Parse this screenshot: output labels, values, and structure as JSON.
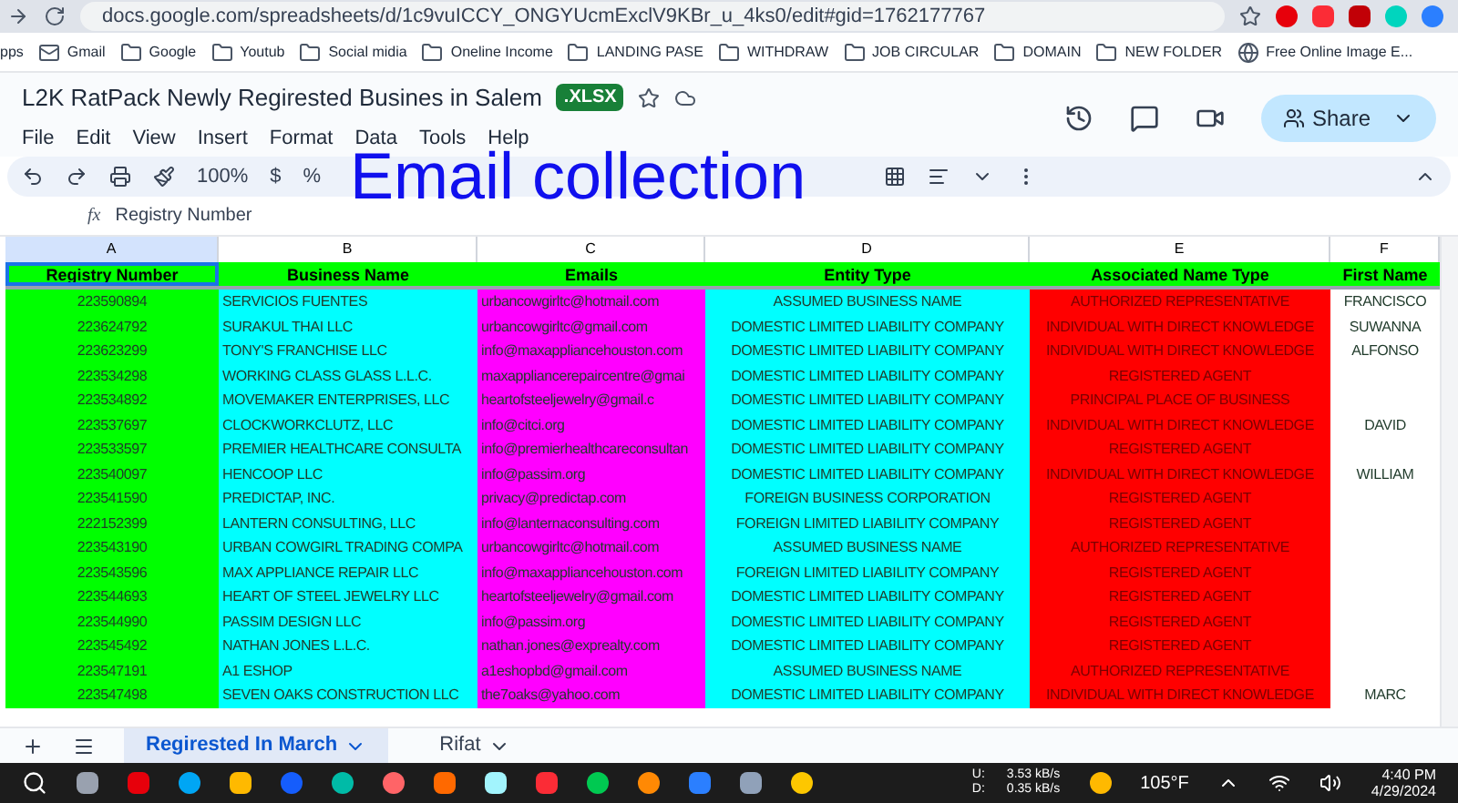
{
  "browser": {
    "url": "docs.google.com/spreadsheets/d/1c9vuICCY_ONGYUcmExclV9KBr_u_4ks0/edit#gid=1762177767",
    "bookmarks": [
      {
        "label": "pps",
        "kind": "apps"
      },
      {
        "label": "Gmail",
        "kind": "mail"
      },
      {
        "label": "Google",
        "kind": "folder"
      },
      {
        "label": "Youtub",
        "kind": "folder"
      },
      {
        "label": "Social midia",
        "kind": "folder"
      },
      {
        "label": "Oneline Income",
        "kind": "folder"
      },
      {
        "label": "LANDING PASE",
        "kind": "folder"
      },
      {
        "label": "WITHDRAW",
        "kind": "folder"
      },
      {
        "label": "JOB CIRCULAR",
        "kind": "folder"
      },
      {
        "label": "DOMAIN",
        "kind": "folder"
      },
      {
        "label": "NEW FOLDER",
        "kind": "folder"
      },
      {
        "label": "Free Online Image E...",
        "kind": "site"
      }
    ]
  },
  "doc": {
    "title": "L2K RatPack Newly Regirested Busines in Salem",
    "badge": ".XLSX",
    "menu": [
      "File",
      "Edit",
      "View",
      "Insert",
      "Format",
      "Data",
      "Tools",
      "Help"
    ],
    "share": "Share",
    "zoom": "100%",
    "currency": "$",
    "percent": "%",
    "overlay": "Email collection"
  },
  "formula_bar": {
    "fx": "fx",
    "value": "Registry Number"
  },
  "table": {
    "columns": [
      {
        "letter": "A",
        "header": "Registry Number",
        "color": "#00ff00",
        "selected": true
      },
      {
        "letter": "B",
        "header": "Business Name",
        "color": "#00ffff",
        "selected": false
      },
      {
        "letter": "C",
        "header": "Emails",
        "color": "#ff00ff",
        "selected": false
      },
      {
        "letter": "D",
        "header": "Entity Type",
        "color": "#00ffff",
        "selected": false
      },
      {
        "letter": "E",
        "header": "Associated Name Type",
        "color": "#ff0000",
        "selected": false
      },
      {
        "letter": "F",
        "header": "First Name",
        "color": "#ffffff",
        "selected": false
      }
    ],
    "rows": [
      [
        "223590894",
        "SERVICIOS FUENTES",
        "urbancowgirltc@hotmail.com",
        "ASSUMED BUSINESS NAME",
        "AUTHORIZED REPRESENTATIVE",
        "FRANCISCO"
      ],
      [
        "223624792",
        "SURAKUL THAI LLC",
        "urbancowgirltc@gmail.com",
        "DOMESTIC LIMITED LIABILITY COMPANY",
        "INDIVIDUAL WITH DIRECT KNOWLEDGE",
        "SUWANNA"
      ],
      [
        "223623299",
        "TONY'S FRANCHISE LLC",
        "info@maxappliancehouston.com",
        "DOMESTIC LIMITED LIABILITY COMPANY",
        "INDIVIDUAL WITH DIRECT KNOWLEDGE",
        "ALFONSO"
      ],
      [
        "223534298",
        "WORKING CLASS GLASS L.L.C.",
        "maxappliancerepaircentre@gmai",
        "DOMESTIC LIMITED LIABILITY COMPANY",
        "REGISTERED AGENT",
        null
      ],
      [
        "223534892",
        "MOVEMAKER ENTERPRISES, LLC",
        "heartofsteeljewelry@gmail.c",
        "DOMESTIC LIMITED LIABILITY COMPANY",
        "PRINCIPAL PLACE OF BUSINESS",
        null
      ],
      [
        "223537697",
        "CLOCKWORKCLUTZ, LLC",
        "info@citci.org",
        "DOMESTIC LIMITED LIABILITY COMPANY",
        "INDIVIDUAL WITH DIRECT KNOWLEDGE",
        "DAVID"
      ],
      [
        "223533597",
        "PREMIER HEALTHCARE CONSULTA",
        "info@premierhealthcareconsultan",
        "DOMESTIC LIMITED LIABILITY COMPANY",
        "REGISTERED AGENT",
        null
      ],
      [
        "223540097",
        "HENCOOP LLC",
        "info@passim.org",
        "DOMESTIC LIMITED LIABILITY COMPANY",
        "INDIVIDUAL WITH DIRECT KNOWLEDGE",
        "WILLIAM"
      ],
      [
        "223541590",
        "PREDICTAP, INC.",
        "privacy@predictap.com",
        "FOREIGN BUSINESS CORPORATION",
        "REGISTERED AGENT",
        null
      ],
      [
        "222152399",
        "LANTERN CONSULTING, LLC",
        "info@lanternaconsulting.com",
        "FOREIGN LIMITED LIABILITY COMPANY",
        "REGISTERED AGENT",
        null
      ],
      [
        "223543190",
        "URBAN COWGIRL TRADING COMPA",
        "urbancowgirltc@hotmail.com",
        "ASSUMED BUSINESS NAME",
        "AUTHORIZED REPRESENTATIVE",
        null
      ],
      [
        "223543596",
        "MAX APPLIANCE REPAIR LLC",
        "info@maxappliancehouston.com",
        "FOREIGN LIMITED LIABILITY COMPANY",
        "REGISTERED AGENT",
        null
      ],
      [
        "223544693",
        "HEART OF STEEL JEWELRY LLC",
        "heartofsteeljewelry@gmail.com",
        "DOMESTIC LIMITED LIABILITY COMPANY",
        "REGISTERED AGENT",
        null
      ],
      [
        "223544990",
        "PASSIM DESIGN LLC",
        "info@passim.org",
        "DOMESTIC LIMITED LIABILITY COMPANY",
        "REGISTERED AGENT",
        null
      ],
      [
        "223545492",
        "NATHAN JONES L.L.C.",
        "nathan.jones@exprealty.com",
        "DOMESTIC LIMITED LIABILITY COMPANY",
        "REGISTERED AGENT",
        null
      ],
      [
        "223547191",
        "A1 ESHOP",
        "a1eshopbd@gmail.com",
        "ASSUMED BUSINESS NAME",
        "AUTHORIZED REPRESENTATIVE",
        null
      ],
      [
        "223547498",
        "SEVEN OAKS CONSTRUCTION LLC",
        "the7oaks@yahoo.com",
        "DOMESTIC LIMITED LIABILITY COMPANY",
        "INDIVIDUAL WITH DIRECT KNOWLEDGE",
        "MARC"
      ]
    ]
  },
  "sheet_tabs": [
    {
      "label": "Regirested In March",
      "selected": true
    },
    {
      "label": "Rifat",
      "selected": false
    }
  ],
  "taskbar": {
    "up_label": "U:",
    "up_rate": "3.53 kB/s",
    "down_label": "D:",
    "down_rate": "0.35 kB/s",
    "weather": "105°F",
    "time": "4:40 PM",
    "date": "4/29/2024"
  }
}
